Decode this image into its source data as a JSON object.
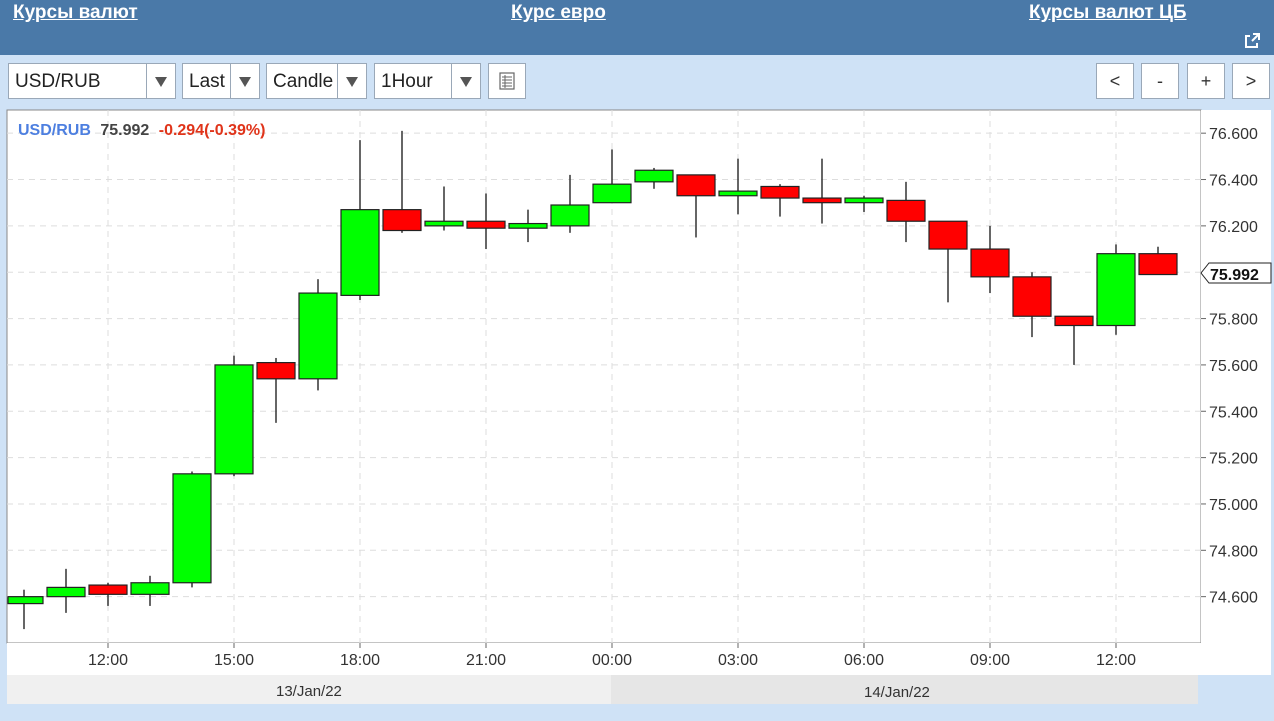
{
  "nav": {
    "link1": "Курсы валют",
    "link2": "Курс евро",
    "link3": "Курсы валют ЦБ",
    "expand_icon": "expand-icon"
  },
  "toolbar": {
    "symbol": "USD/RUB",
    "price_type": "Last",
    "chart_type": "Candle",
    "interval": "1Hour",
    "settings_icon": "list-icon",
    "btn_prev": "<",
    "btn_zoom_out": "-",
    "btn_zoom_in": "+",
    "btn_next": ">"
  },
  "header": {
    "symbol": "USD/RUB",
    "price": "75.992",
    "change": "-0.294(-0.39%)"
  },
  "colors": {
    "up": "#00ff00",
    "down": "#ff0000",
    "symbol_text": "#4d7fe0",
    "change_text": "#e0341a"
  },
  "chart_data": {
    "type": "candlestick",
    "interval": "1 hour",
    "ylim": [
      74.4,
      76.7
    ],
    "y_ticks": [
      "74.600",
      "74.800",
      "75.000",
      "75.200",
      "75.400",
      "75.600",
      "75.800",
      "76.000",
      "76.200",
      "76.400",
      "76.600"
    ],
    "x_ticks": [
      "12:00",
      "15:00",
      "18:00",
      "21:00",
      "00:00",
      "03:00",
      "06:00",
      "09:00",
      "12:00"
    ],
    "date_labels": [
      "13/Jan/22",
      "14/Jan/22"
    ],
    "last_price_label": "75.992",
    "grid": true,
    "candles": [
      {
        "open": 74.57,
        "high": 74.63,
        "low": 74.46,
        "close": 74.6
      },
      {
        "open": 74.6,
        "high": 74.72,
        "low": 74.53,
        "close": 74.64
      },
      {
        "open": 74.65,
        "high": 74.66,
        "low": 74.56,
        "close": 74.61
      },
      {
        "open": 74.61,
        "high": 74.69,
        "low": 74.56,
        "close": 74.66
      },
      {
        "open": 74.66,
        "high": 75.14,
        "low": 74.64,
        "close": 75.13
      },
      {
        "open": 75.13,
        "high": 75.64,
        "low": 75.12,
        "close": 75.6
      },
      {
        "open": 75.61,
        "high": 75.63,
        "low": 75.35,
        "close": 75.54
      },
      {
        "open": 75.54,
        "high": 75.97,
        "low": 75.49,
        "close": 75.91
      },
      {
        "open": 75.9,
        "high": 76.57,
        "low": 75.88,
        "close": 76.27
      },
      {
        "open": 76.27,
        "high": 76.61,
        "low": 76.17,
        "close": 76.18
      },
      {
        "open": 76.2,
        "high": 76.37,
        "low": 76.18,
        "close": 76.22
      },
      {
        "open": 76.22,
        "high": 76.34,
        "low": 76.1,
        "close": 76.19
      },
      {
        "open": 76.19,
        "high": 76.27,
        "low": 76.13,
        "close": 76.21
      },
      {
        "open": 76.2,
        "high": 76.42,
        "low": 76.17,
        "close": 76.29
      },
      {
        "open": 76.3,
        "high": 76.53,
        "low": 76.3,
        "close": 76.38
      },
      {
        "open": 76.39,
        "high": 76.45,
        "low": 76.36,
        "close": 76.44
      },
      {
        "open": 76.42,
        "high": 76.42,
        "low": 76.15,
        "close": 76.33
      },
      {
        "open": 76.33,
        "high": 76.49,
        "low": 76.25,
        "close": 76.35
      },
      {
        "open": 76.37,
        "high": 76.38,
        "low": 76.24,
        "close": 76.32
      },
      {
        "open": 76.32,
        "high": 76.49,
        "low": 76.21,
        "close": 76.3
      },
      {
        "open": 76.3,
        "high": 76.33,
        "low": 76.26,
        "close": 76.32
      },
      {
        "open": 76.31,
        "high": 76.39,
        "low": 76.13,
        "close": 76.22
      },
      {
        "open": 76.22,
        "high": 76.22,
        "low": 75.87,
        "close": 76.1
      },
      {
        "open": 76.1,
        "high": 76.2,
        "low": 75.91,
        "close": 75.98
      },
      {
        "open": 75.98,
        "high": 76.0,
        "low": 75.72,
        "close": 75.81
      },
      {
        "open": 75.81,
        "high": 75.81,
        "low": 75.6,
        "close": 75.77
      },
      {
        "open": 75.77,
        "high": 76.12,
        "low": 75.73,
        "close": 76.08
      },
      {
        "open": 76.08,
        "high": 76.11,
        "low": 76.0,
        "close": 75.99
      }
    ]
  }
}
